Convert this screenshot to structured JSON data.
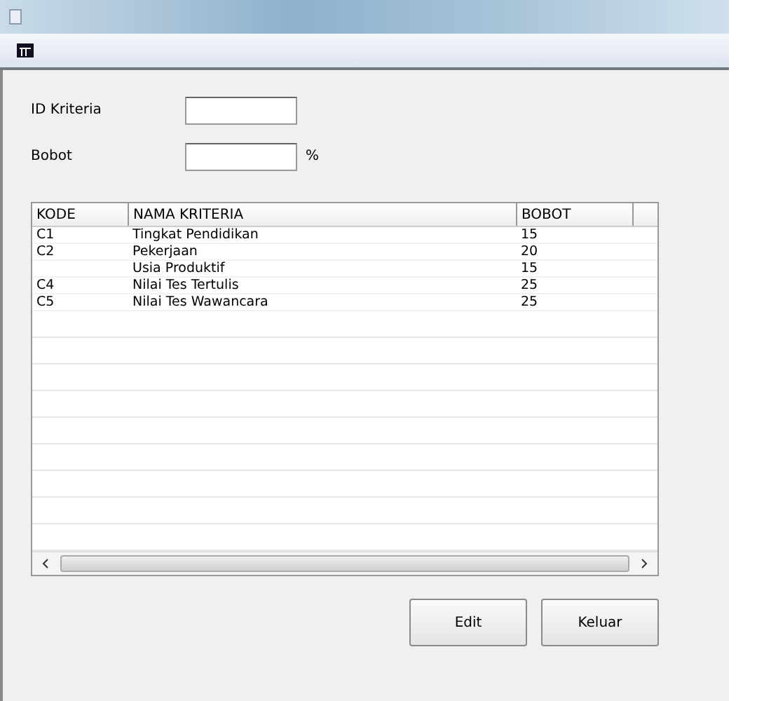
{
  "form": {
    "fields": [
      {
        "label": "ID Kriteria"
      },
      {
        "label": "Bobot",
        "suffix": "%"
      }
    ]
  },
  "table": {
    "columns": [
      "KODE",
      "NAMA KRITERIA",
      "BOBOT"
    ],
    "rows": [
      [
        "C1",
        "Tingkat Pendidikan",
        "15"
      ],
      [
        "C2",
        "Pekerjaan",
        "20"
      ],
      [
        "",
        "Usia Produktif",
        "15"
      ],
      [
        "C4",
        "Nilai Tes Tertulis",
        "25"
      ],
      [
        "C5",
        "Nilai Tes Wawancara",
        "25"
      ]
    ]
  },
  "buttons": [
    "Edit",
    "Keluar"
  ]
}
